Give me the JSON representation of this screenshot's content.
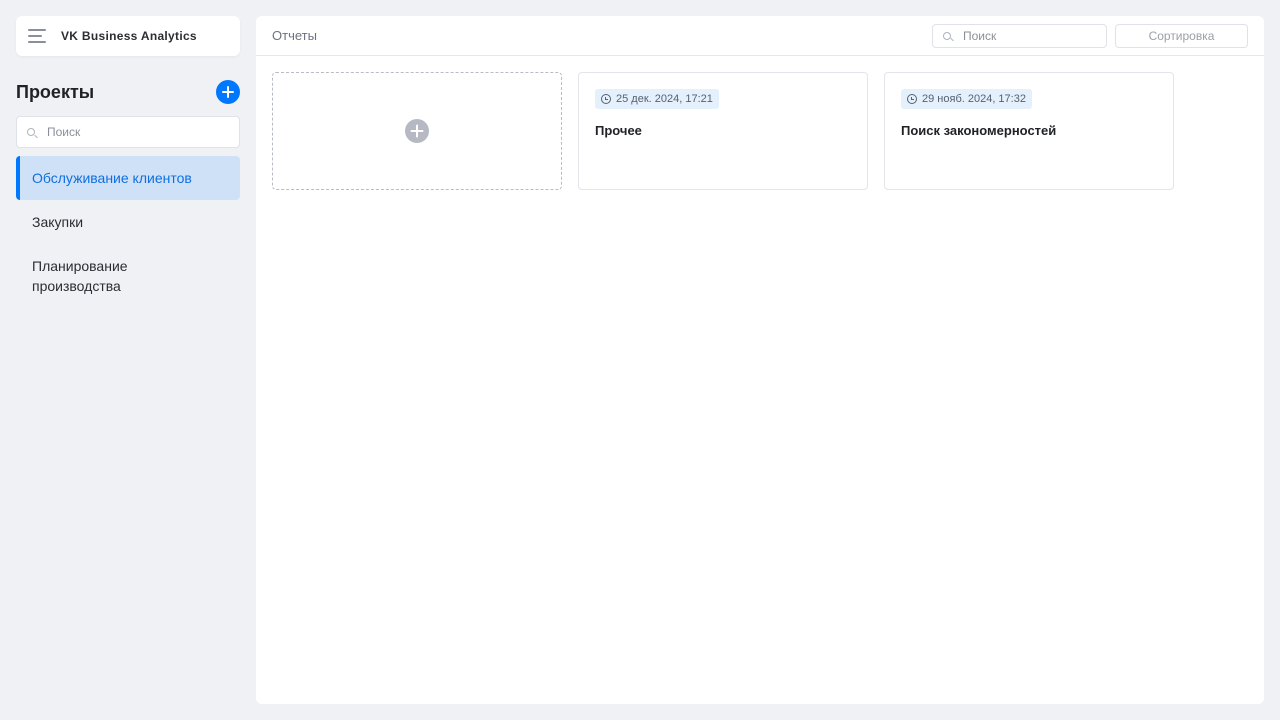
{
  "app": {
    "brand": "VK Business Analytics"
  },
  "sidebar": {
    "title": "Проекты",
    "search_placeholder": "Поиск",
    "items": [
      {
        "label": "Обслуживание клиентов",
        "active": true
      },
      {
        "label": "Закупки",
        "active": false
      },
      {
        "label": "Планирование производства",
        "active": false
      }
    ]
  },
  "main": {
    "title": "Отчеты",
    "search_placeholder": "Поиск",
    "sort_label": "Сортировка",
    "cards": [
      {
        "date": "25 дек. 2024, 17:21",
        "title": "Прочее"
      },
      {
        "date": "29 нояб. 2024, 17:32",
        "title": "Поиск закономерностей"
      }
    ]
  },
  "colors": {
    "accent": "#0077ff",
    "active_bg": "#cfe1f7",
    "page_bg": "#eff1f5",
    "badge_bg": "#e4f0fc"
  }
}
